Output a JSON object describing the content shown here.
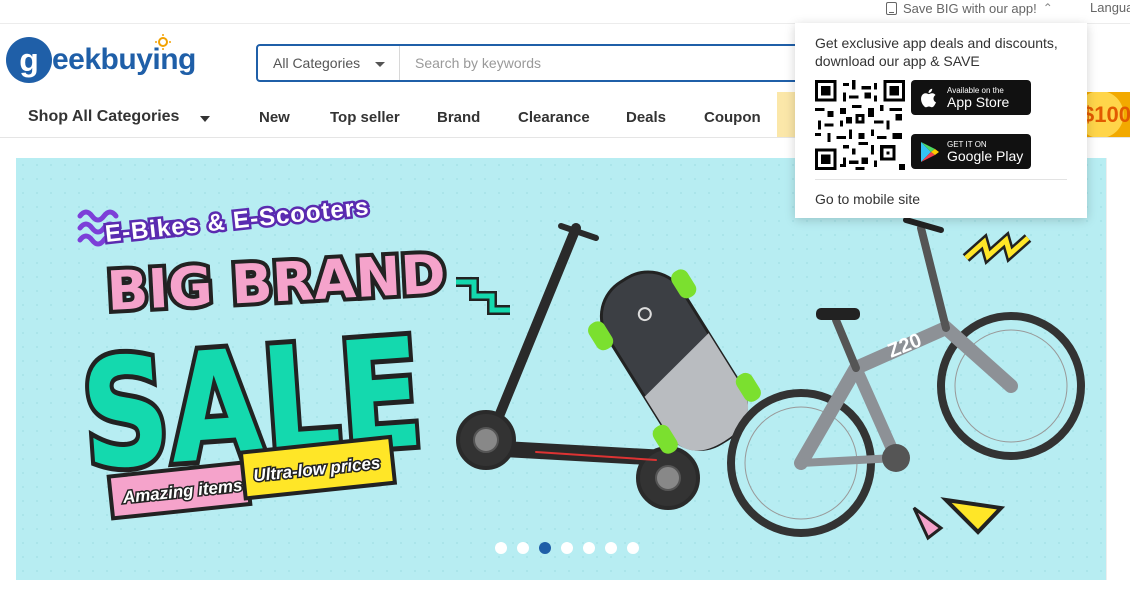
{
  "topbar": {
    "app_link": "Save BIG with our app!",
    "language": "Langua"
  },
  "search": {
    "category": "All Categories",
    "placeholder": "Search by keywords"
  },
  "nav": {
    "shop_all": "Shop All Categories",
    "items": [
      "New",
      "Top seller",
      "Brand",
      "Clearance",
      "Deals",
      "Coupon"
    ],
    "promo_badge": "$100"
  },
  "banner": {
    "headline_top": "E-Bikes & E-Scooters",
    "headline_big1": "BIG BRAND",
    "headline_big2": "SALE",
    "tag1": "Amazing items",
    "tag2": "Ultra-low prices",
    "bike_model": "Z20",
    "slide_count": 7,
    "active_slide": 3,
    "colors": {
      "bg": "#b7edf2",
      "teal": "#14d9ae",
      "pink": "#f5a3cb",
      "yellow": "#ffe627",
      "purple": "#7c3fd8"
    }
  },
  "popup": {
    "text": "Get exclusive app deals and discounts, download our app & SAVE",
    "app_store_small": "Available on the",
    "app_store_big": "App Store",
    "google_small": "GET IT ON",
    "google_big": "Google Play",
    "mobile_link": "Go to mobile site"
  },
  "brand": {
    "name": "geekbuying",
    "primary": "#1f5fa8"
  }
}
